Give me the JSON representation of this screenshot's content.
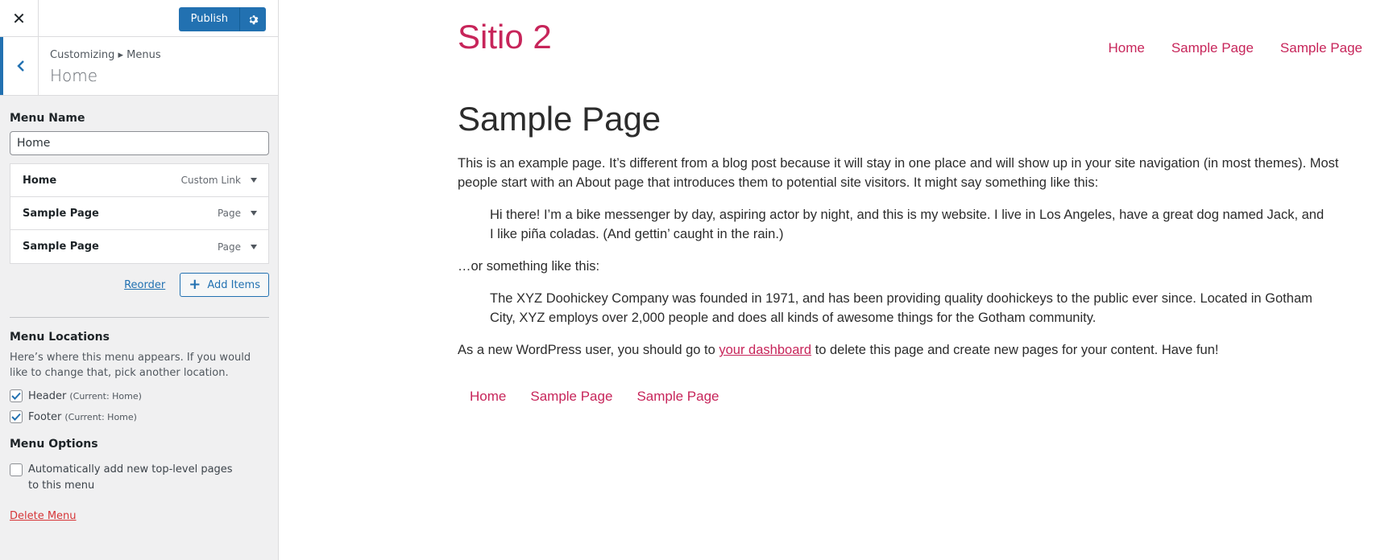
{
  "topbar": {
    "close_label": "✕",
    "publish_label": "Publish"
  },
  "section": {
    "breadcrumb_root": "Customizing",
    "breadcrumb_sep": "▸",
    "breadcrumb_current": "Menus",
    "title": "Home"
  },
  "menu": {
    "name_label": "Menu Name",
    "name_value": "Home",
    "items": [
      {
        "title": "Home",
        "type": "Custom Link"
      },
      {
        "title": "Sample Page",
        "type": "Page"
      },
      {
        "title": "Sample Page",
        "type": "Page"
      }
    ],
    "reorder_label": "Reorder",
    "add_items_label": "Add Items"
  },
  "locations": {
    "title": "Menu Locations",
    "help": "Here’s where this menu appears. If you would like to change that, pick another location.",
    "options": [
      {
        "label": "Header",
        "current": "(Current: Home)",
        "checked": true
      },
      {
        "label": "Footer",
        "current": "(Current: Home)",
        "checked": true
      }
    ]
  },
  "options": {
    "title": "Menu Options",
    "auto_add_label": "Automatically add new top-level pages to this menu",
    "auto_add_checked": false
  },
  "delete_label": "Delete Menu",
  "preview": {
    "site_title": "Sitio 2",
    "header_nav": [
      "Home",
      "Sample Page",
      "Sample Page"
    ],
    "page_title": "Sample Page",
    "para1": "This is an example page. It’s different from a blog post because it will stay in one place and will show up in your site navigation (in most themes). Most people start with an About page that introduces them to potential site visitors. It might say something like this:",
    "quote1": "Hi there! I’m a bike messenger by day, aspiring actor by night, and this is my website. I live in Los Angeles, have a great dog named Jack, and I like piña coladas. (And gettin’ caught in the rain.)",
    "para2": "…or something like this:",
    "quote2": "The XYZ Doohickey Company was founded in 1971, and has been providing quality doohickeys to the public ever since. Located in Gotham City, XYZ employs over 2,000 people and does all kinds of awesome things for the Gotham community.",
    "para3_before": "As a new WordPress user, you should go to ",
    "para3_link": "your dashboard",
    "para3_after": " to delete this page and create new pages for your content. Have fun!",
    "footer_nav": [
      "Home",
      "Sample Page",
      "Sample Page"
    ]
  },
  "colors": {
    "accent": "#2271b1",
    "link_pink": "#c7255a",
    "delete_red": "#d63638"
  }
}
